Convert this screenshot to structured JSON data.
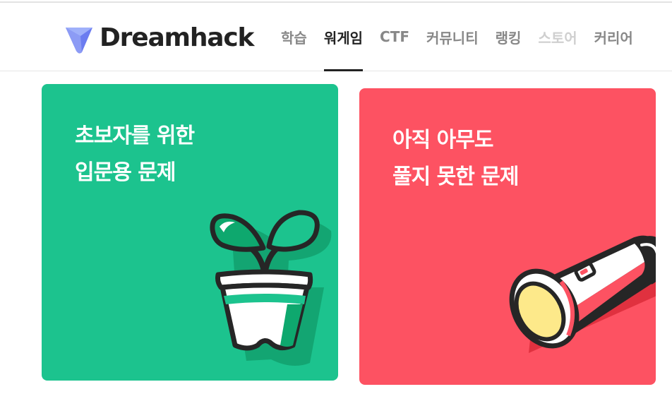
{
  "header": {
    "logo_text": "Dreamhack",
    "nav": [
      {
        "label": "학습",
        "state": "normal"
      },
      {
        "label": "워게임",
        "state": "active"
      },
      {
        "label": "CTF",
        "state": "normal"
      },
      {
        "label": "커뮤니티",
        "state": "normal"
      },
      {
        "label": "랭킹",
        "state": "normal"
      },
      {
        "label": "스토어",
        "state": "disabled"
      },
      {
        "label": "커리어",
        "state": "normal"
      }
    ]
  },
  "cards": [
    {
      "line1": "초보자를 위한",
      "line2": "입문용 문제",
      "color": "#1cc38e",
      "illustration": "sprout-pot-icon"
    },
    {
      "line1": "아직 아무도",
      "line2": "풀지 못한 문제",
      "color": "#fd5262",
      "illustration": "flashlight-icon"
    }
  ]
}
